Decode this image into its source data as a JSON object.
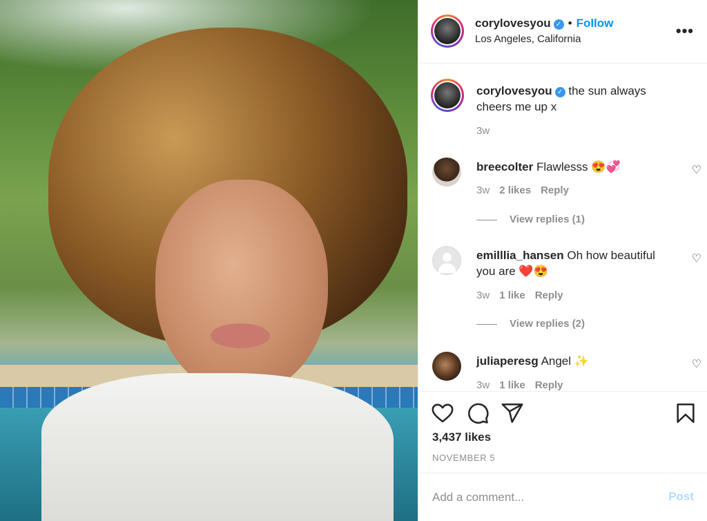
{
  "post": {
    "username": "corylovesyou",
    "verified_icon": "verified-badge-icon",
    "follow_label": "Follow",
    "separator": "•",
    "location": "Los Angeles, California",
    "more_label": "•••"
  },
  "caption": {
    "username": "corylovesyou",
    "text": "the sun always cheers me up x",
    "time": "3w"
  },
  "comments": [
    {
      "username": "breecolter",
      "text": "Flawlesss 😍💞",
      "time": "3w",
      "likes": "2 likes",
      "reply": "Reply",
      "view_replies": "View replies (1)"
    },
    {
      "username": "emilllia_hansen",
      "text": "Oh how beautiful you are ❤️😍",
      "time": "3w",
      "likes": "1 like",
      "reply": "Reply",
      "view_replies": "View replies (2)"
    },
    {
      "username": "juliaperesg",
      "text": "Angel ✨",
      "time": "3w",
      "likes": "1 like",
      "reply": "Reply"
    }
  ],
  "actions": {
    "like_icon": "heart-icon",
    "comment_icon": "comment-bubble-icon",
    "share_icon": "paper-plane-icon",
    "save_icon": "bookmark-icon",
    "likes_count": "3,437 likes",
    "date": "NOVEMBER 5"
  },
  "add_comment": {
    "placeholder": "Add a comment...",
    "post_label": "Post"
  },
  "colors": {
    "link_blue": "#0095f6",
    "muted": "#8e8e8e",
    "post_disabled": "#b3dbff"
  }
}
